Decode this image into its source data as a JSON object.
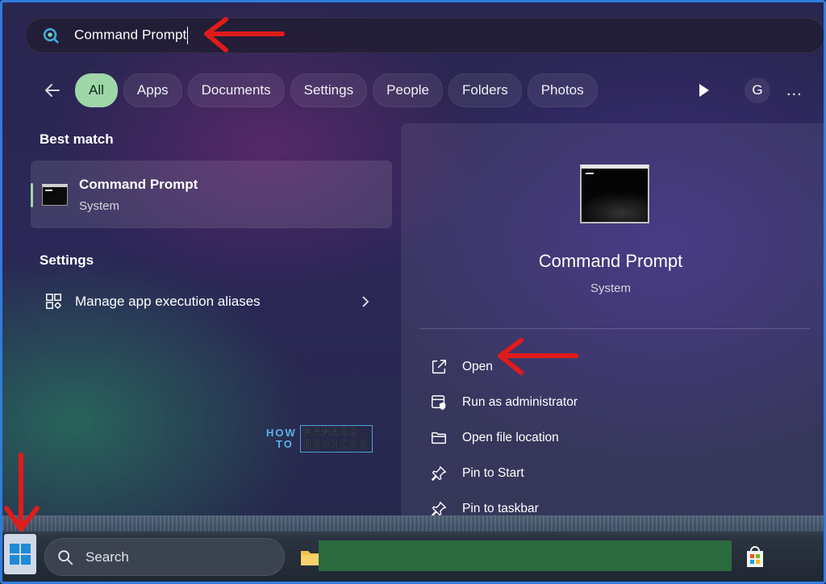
{
  "search": {
    "query": "Command Prompt"
  },
  "filters": {
    "tabs": [
      {
        "label": "All",
        "active": true
      },
      {
        "label": "Apps"
      },
      {
        "label": "Documents"
      },
      {
        "label": "Settings"
      },
      {
        "label": "People"
      },
      {
        "label": "Folders"
      },
      {
        "label": "Photos"
      }
    ],
    "avatar_letter": "G",
    "more_label": "..."
  },
  "results": {
    "best_match_title": "Best match",
    "best_match": {
      "name": "Command Prompt",
      "type": "System"
    },
    "settings_title": "Settings",
    "settings_items": [
      {
        "label": "Manage app execution aliases"
      }
    ]
  },
  "preview": {
    "name": "Command Prompt",
    "type": "System",
    "actions": [
      {
        "label": "Open",
        "icon": "open-external-icon"
      },
      {
        "label": "Run as administrator",
        "icon": "admin-shield-icon"
      },
      {
        "label": "Open file location",
        "icon": "folder-icon"
      },
      {
        "label": "Pin to Start",
        "icon": "pin-icon"
      },
      {
        "label": "Pin to taskbar",
        "icon": "pin-icon"
      }
    ]
  },
  "watermark": {
    "line1": "HOW",
    "line2": "TO",
    "box1": "MANAGE",
    "box2": "DEVICES"
  },
  "taskbar": {
    "search_label": "Search"
  },
  "colors": {
    "accent_green": "#9fd6a8",
    "annotation_red": "#e01b1b",
    "frame_blue": "#2f7de1"
  }
}
